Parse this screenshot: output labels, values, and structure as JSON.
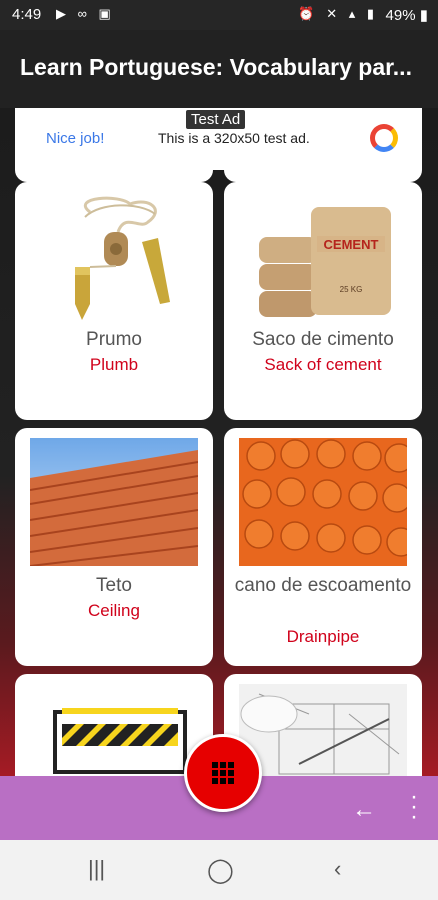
{
  "status": {
    "time": "4:49",
    "battery": "49%"
  },
  "app_bar": {
    "title": "Learn Portuguese: Vocabulary par..."
  },
  "ad": {
    "tag": "Test Ad",
    "nice": "Nice job!",
    "message": "This is a 320x50 test ad."
  },
  "cards": [
    {
      "pt": "Prumo",
      "en": "Plumb"
    },
    {
      "pt": "Saco de cimento",
      "en": "Sack of cement"
    },
    {
      "pt": "Teto",
      "en": "Ceiling"
    },
    {
      "pt": "cano de escoamento",
      "en": "Drainpipe"
    }
  ],
  "cement_bag": {
    "label": "CEMENT",
    "weight": "25 KG"
  },
  "icons": {
    "back": "arrow-left-icon",
    "more": "more-vertical-icon",
    "fab": "grid-icon",
    "recent": "recent-apps-icon",
    "home": "home-icon",
    "nav_back": "nav-back-icon"
  }
}
